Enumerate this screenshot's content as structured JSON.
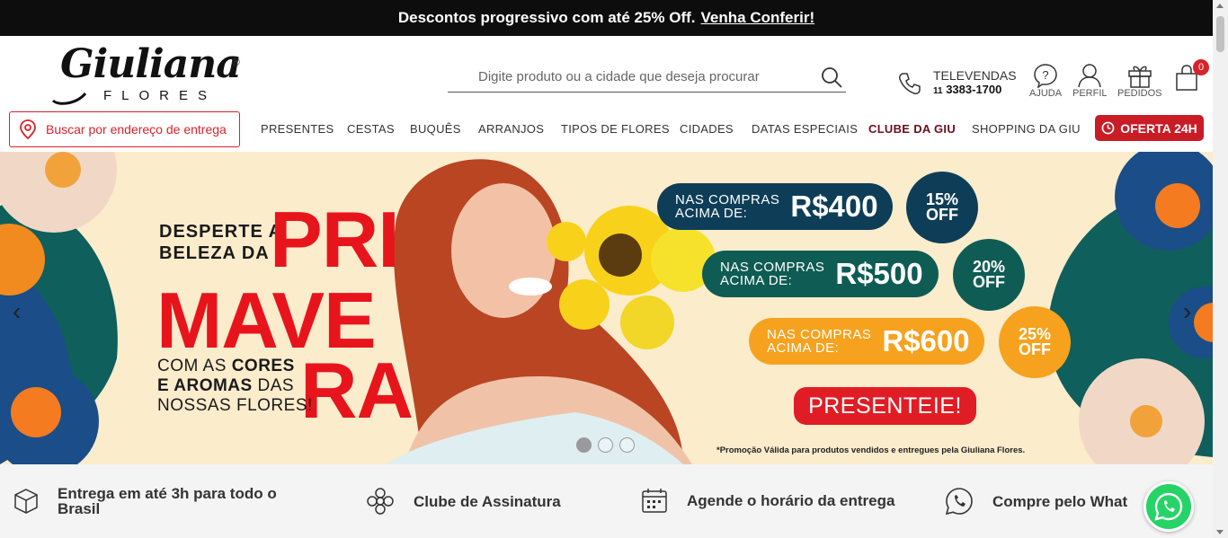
{
  "topbar": {
    "text": "Descontos progressivo com até 25% Off.",
    "link": "Venha Conferir!"
  },
  "logo": {
    "name": "Giuliana",
    "sub": "FLORES",
    "reg": "®"
  },
  "search": {
    "placeholder": "Digite produto ou a cidade que deseja procurar"
  },
  "televendas": {
    "label": "TELEVENDAS",
    "ddd": "11",
    "number": "3383-1700"
  },
  "header_icons": {
    "help": "AJUDA",
    "profile": "PERFIL",
    "orders": "PEDIDOS",
    "cart_count": "0"
  },
  "address_button": {
    "label": "Buscar por endereço de entrega"
  },
  "nav": {
    "items": [
      "PRESENTES",
      "CESTAS",
      "BUQUÊS",
      "ARRANJOS",
      "TIPOS DE FLORES",
      "CIDADES",
      "DATAS ESPECIAIS",
      "CLUBE DA GIU",
      "SHOPPING DA GIU"
    ],
    "oferta": "OFERTA 24H"
  },
  "banner": {
    "desperte_l1": "DESPERTE A",
    "desperte_l2": "BELEZA DA",
    "big_1": "PRI",
    "big_2": "MAVE",
    "big_3": "RA",
    "cores_l1_a": "COM AS ",
    "cores_l1_b": "CORES",
    "cores_l2_a": "E AROMAS ",
    "cores_l2_b": "DAS",
    "cores_l3": "NOSSAS FLORES!",
    "tiers": [
      {
        "line1": "NAS COMPRAS",
        "line2": "ACIMA DE:",
        "amount": "R$400",
        "off": "15%",
        "off_label": "OFF",
        "color": "#0e3e57"
      },
      {
        "line1": "NAS COMPRAS",
        "line2": "ACIMA DE:",
        "amount": "R$500",
        "off": "20%",
        "off_label": "OFF",
        "color": "#0f5c54"
      },
      {
        "line1": "NAS COMPRAS",
        "line2": "ACIMA DE:",
        "amount": "R$600",
        "off": "25%",
        "off_label": "OFF",
        "color": "#f6a21e"
      }
    ],
    "cta": "PRESENTEIE!",
    "promo": "*Promoção Válida para produtos vendidos e entregues pela Giuliana Flores.",
    "slides_active_index": 0
  },
  "features": [
    {
      "label": "Entrega em até 3h para todo o Brasil",
      "icon": "box-icon"
    },
    {
      "label": "Clube de Assinatura",
      "icon": "flower-icon"
    },
    {
      "label": "Agende o horário da entrega",
      "icon": "calendar-icon"
    },
    {
      "label": "Compre pelo What",
      "icon": "whatsapp-icon"
    }
  ],
  "colors": {
    "brand_red": "#d92229",
    "banner_bg": "#fbeccc",
    "topbar_bg": "#0d0d0d",
    "whatsapp": "#25d366"
  }
}
